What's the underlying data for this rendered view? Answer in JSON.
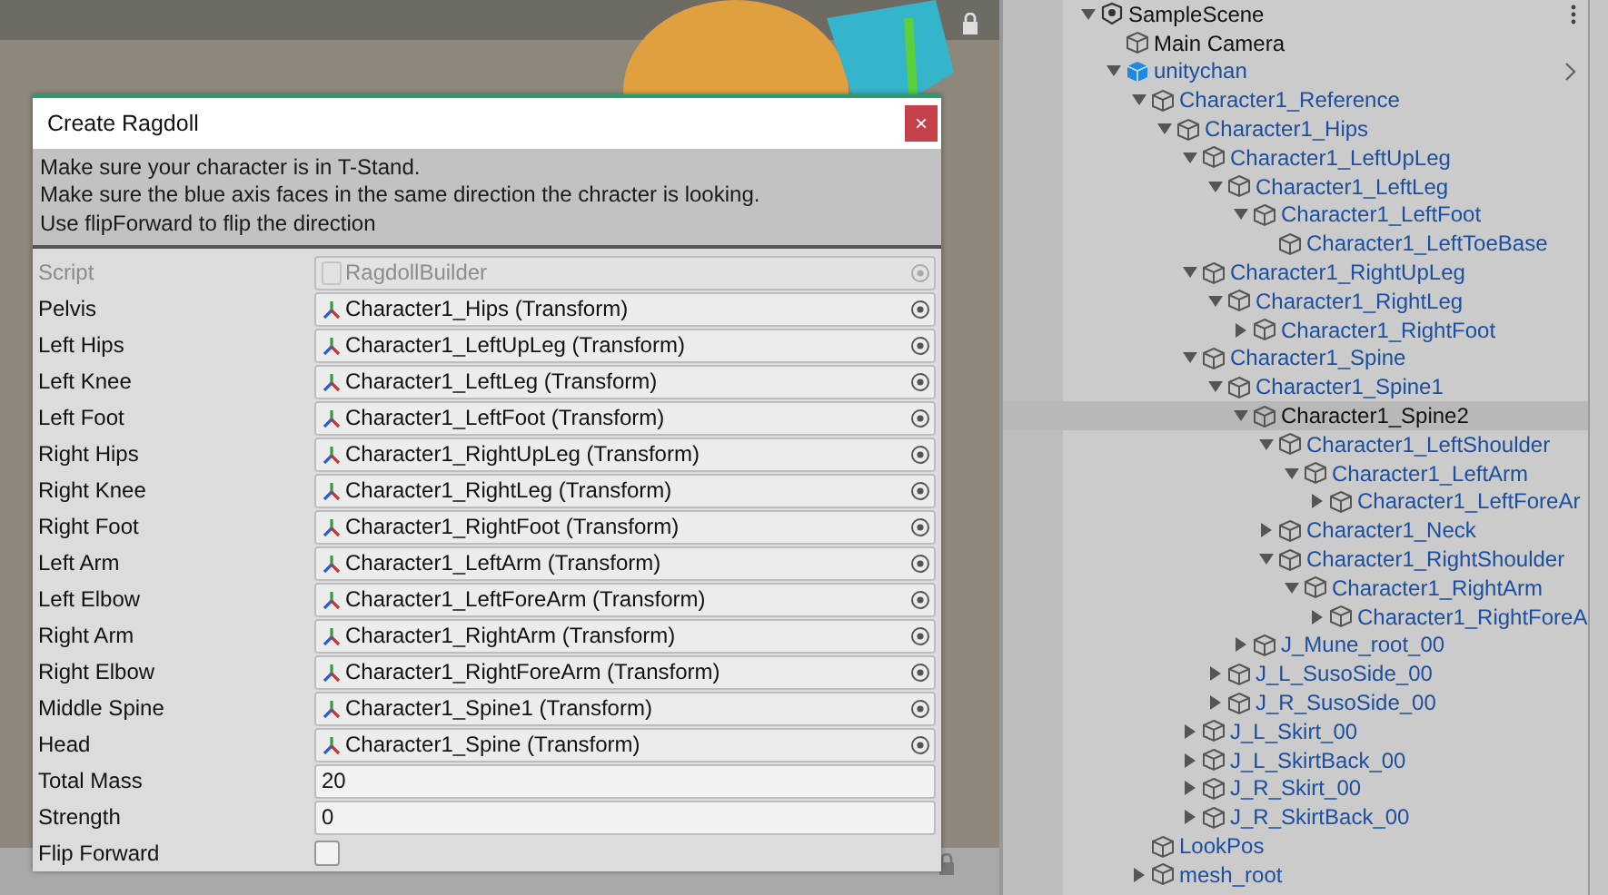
{
  "dialog": {
    "title": "Create Ragdoll",
    "close": "×",
    "help": [
      "Make sure your character is in T-Stand.",
      "Make sure the blue axis faces in the same direction the chracter is looking.",
      "Use flipForward to flip the direction"
    ]
  },
  "script": {
    "label": "Script",
    "value": "RagdollBuilder"
  },
  "fields": [
    {
      "kind": "object",
      "label": "Pelvis",
      "value": "Character1_Hips (Transform)"
    },
    {
      "kind": "object",
      "label": "Left Hips",
      "value": "Character1_LeftUpLeg (Transform)"
    },
    {
      "kind": "object",
      "label": "Left Knee",
      "value": "Character1_LeftLeg (Transform)"
    },
    {
      "kind": "object",
      "label": "Left Foot",
      "value": "Character1_LeftFoot (Transform)"
    },
    {
      "kind": "object",
      "label": "Right Hips",
      "value": "Character1_RightUpLeg (Transform)"
    },
    {
      "kind": "object",
      "label": "Right Knee",
      "value": "Character1_RightLeg (Transform)"
    },
    {
      "kind": "object",
      "label": "Right Foot",
      "value": "Character1_RightFoot (Transform)"
    },
    {
      "kind": "object",
      "label": "Left Arm",
      "value": "Character1_LeftArm (Transform)"
    },
    {
      "kind": "object",
      "label": "Left Elbow",
      "value": "Character1_LeftForeArm (Transform)"
    },
    {
      "kind": "object",
      "label": "Right Arm",
      "value": "Character1_RightArm (Transform)"
    },
    {
      "kind": "object",
      "label": "Right Elbow",
      "value": "Character1_RightForeArm (Transform)"
    },
    {
      "kind": "object",
      "label": "Middle Spine",
      "value": "Character1_Spine1 (Transform)"
    },
    {
      "kind": "object",
      "label": "Head",
      "value": "Character1_Spine (Transform)"
    },
    {
      "kind": "number",
      "label": "Total Mass",
      "value": "20"
    },
    {
      "kind": "number",
      "label": "Strength",
      "value": "0"
    },
    {
      "kind": "toggle",
      "label": "Flip Forward",
      "checked": false
    }
  ],
  "hierarchy": [
    {
      "name": "SampleScene",
      "kind": "scene",
      "selected": false,
      "expanded": true,
      "children": [
        {
          "name": "Main Camera",
          "kind": "object",
          "selected": false
        },
        {
          "name": "unitychan",
          "kind": "prefab_root",
          "selected": false,
          "expanded": true,
          "children": [
            {
              "name": "Character1_Reference",
              "kind": "prefab",
              "selected": false,
              "expanded": true,
              "children": [
                {
                  "name": "Character1_Hips",
                  "kind": "prefab",
                  "selected": false,
                  "expanded": true,
                  "children": [
                    {
                      "name": "Character1_LeftUpLeg",
                      "kind": "prefab",
                      "selected": false,
                      "expanded": true,
                      "children": [
                        {
                          "name": "Character1_LeftLeg",
                          "kind": "prefab",
                          "selected": false,
                          "expanded": true,
                          "children": [
                            {
                              "name": "Character1_LeftFoot",
                              "kind": "prefab",
                              "selected": false,
                              "expanded": true,
                              "children": [
                                {
                                  "name": "Character1_LeftToeBase",
                                  "kind": "prefab",
                                  "selected": false
                                }
                              ]
                            }
                          ]
                        }
                      ]
                    },
                    {
                      "name": "Character1_RightUpLeg",
                      "kind": "prefab",
                      "selected": false,
                      "expanded": true,
                      "children": [
                        {
                          "name": "Character1_RightLeg",
                          "kind": "prefab",
                          "selected": false,
                          "expanded": true,
                          "children": [
                            {
                              "name": "Character1_RightFoot",
                              "kind": "prefab",
                              "selected": false,
                              "expanded": false
                            }
                          ]
                        }
                      ]
                    },
                    {
                      "name": "Character1_Spine",
                      "kind": "prefab",
                      "selected": false,
                      "expanded": true,
                      "children": [
                        {
                          "name": "Character1_Spine1",
                          "kind": "prefab",
                          "selected": false,
                          "expanded": true,
                          "children": [
                            {
                              "name": "Character1_Spine2",
                              "kind": "object",
                              "selected": true,
                              "expanded": true,
                              "children": [
                                {
                                  "name": "Character1_LeftShoulder",
                                  "kind": "prefab",
                                  "selected": false,
                                  "expanded": true,
                                  "children": [
                                    {
                                      "name": "Character1_LeftArm",
                                      "kind": "prefab",
                                      "selected": false,
                                      "expanded": true,
                                      "children": [
                                        {
                                          "name": "Character1_LeftForeAr",
                                          "kind": "prefab",
                                          "selected": false,
                                          "expanded": false
                                        }
                                      ]
                                    }
                                  ]
                                },
                                {
                                  "name": "Character1_Neck",
                                  "kind": "prefab",
                                  "selected": false,
                                  "expanded": false
                                },
                                {
                                  "name": "Character1_RightShoulder",
                                  "kind": "prefab",
                                  "selected": false,
                                  "expanded": true,
                                  "children": [
                                    {
                                      "name": "Character1_RightArm",
                                      "kind": "prefab",
                                      "selected": false,
                                      "expanded": true,
                                      "children": [
                                        {
                                          "name": "Character1_RightForeA",
                                          "kind": "prefab",
                                          "selected": false,
                                          "expanded": false
                                        }
                                      ]
                                    }
                                  ]
                                }
                              ]
                            },
                            {
                              "name": "J_Mune_root_00",
                              "kind": "prefab",
                              "selected": false,
                              "expanded": false
                            }
                          ]
                        },
                        {
                          "name": "J_L_SusoSide_00",
                          "kind": "prefab",
                          "selected": false,
                          "expanded": false
                        },
                        {
                          "name": "J_R_SusoSide_00",
                          "kind": "prefab",
                          "selected": false,
                          "expanded": false
                        }
                      ]
                    },
                    {
                      "name": "J_L_Skirt_00",
                      "kind": "prefab",
                      "selected": false,
                      "expanded": false
                    },
                    {
                      "name": "J_L_SkirtBack_00",
                      "kind": "prefab",
                      "selected": false,
                      "expanded": false
                    },
                    {
                      "name": "J_R_Skirt_00",
                      "kind": "prefab",
                      "selected": false,
                      "expanded": false
                    },
                    {
                      "name": "J_R_SkirtBack_00",
                      "kind": "prefab",
                      "selected": false,
                      "expanded": false
                    }
                  ]
                }
              ]
            },
            {
              "name": "LookPos",
              "kind": "prefab",
              "selected": false
            },
            {
              "name": "mesh_root",
              "kind": "prefab",
              "selected": false,
              "expanded": false
            }
          ]
        }
      ]
    }
  ]
}
